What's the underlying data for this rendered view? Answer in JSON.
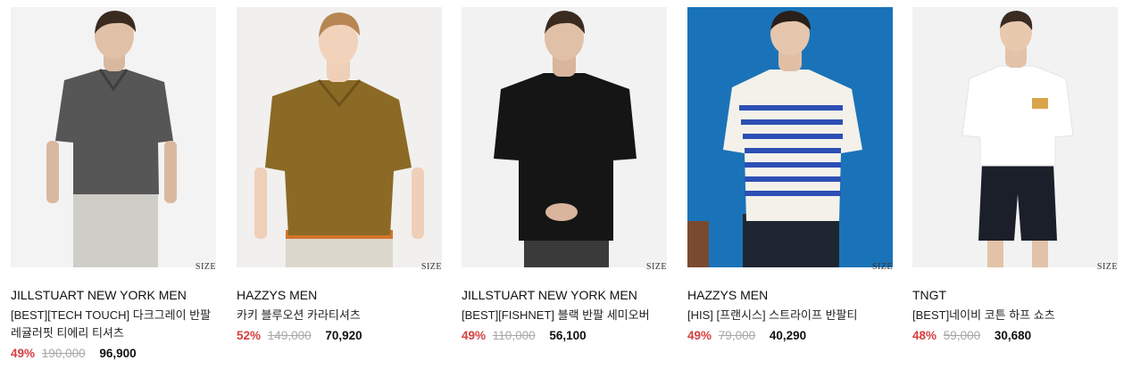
{
  "products": [
    {
      "brand": "JILLSTUART NEW YORK MEN",
      "name": "[BEST][TECH TOUCH] 다크그레이 반팔 레귤러핏 티에리 티셔츠",
      "discount": "49%",
      "original_price": "190,000",
      "price": "96,900",
      "size_label": "SIZE",
      "colors": {
        "bg": "#f3f3f3",
        "top": "#565656",
        "bottom": "#cfcdc7"
      }
    },
    {
      "brand": "HAZZYS MEN",
      "name": "카키 블루오션 카라티셔츠",
      "discount": "52%",
      "original_price": "149,000",
      "price": "70,920",
      "size_label": "SIZE",
      "colors": {
        "bg": "#f1f0ee",
        "top": "#8a6a25",
        "bottom": "#dcd7cc"
      }
    },
    {
      "brand": "JILLSTUART NEW YORK MEN",
      "name": "[BEST][FISHNET] 블랙 반팔 세미오버",
      "discount": "49%",
      "original_price": "110,000",
      "price": "56,100",
      "size_label": "SIZE",
      "colors": {
        "bg": "#f2f2f2",
        "top": "#151515",
        "bottom": "#3a3a3a"
      }
    },
    {
      "brand": "HAZZYS MEN",
      "name": "[HIS] [프랜시스] 스트라이프 반팔티",
      "discount": "49%",
      "original_price": "79,000",
      "price": "40,290",
      "size_label": "SIZE",
      "colors": {
        "bg": "#1a73b8",
        "top": "#f3f1ea",
        "bottom": "#1f2632",
        "stripe": "#2d4fb5"
      }
    },
    {
      "brand": "TNGT",
      "name": "[BEST]네이비 코튼 하프 쇼츠",
      "discount": "48%",
      "original_price": "59,000",
      "price": "30,680",
      "size_label": "SIZE",
      "colors": {
        "bg": "#f2f2f2",
        "top": "#ffffff",
        "bottom": "#1b1f2a"
      }
    }
  ]
}
